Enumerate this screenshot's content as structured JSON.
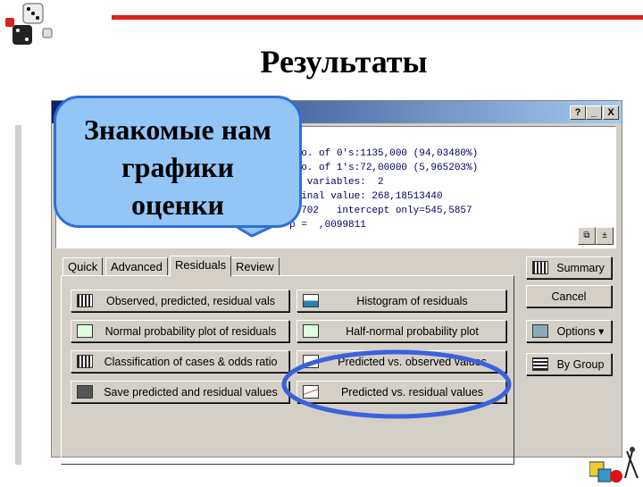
{
  "slide": {
    "title": "Результаты",
    "callout": [
      "Знакомые нам",
      "графики",
      "оценки"
    ]
  },
  "dialog": {
    "titlebar_buttons": {
      "help": "?",
      "minimize": "_",
      "close": "X"
    },
    "output_lines": [
      "git)  No. of 0's:1135,000 (94,03480%)",
      "      No. of 1's:72,00000 (5,965203%)",
      "pendent variables:  2",
      "hood  Final value: 268,18513440",
      "l=536,3702   intercept only=545,5857",
      "     p =  ,0099811"
    ],
    "tabs": [
      "Quick",
      "Advanced",
      "Residuals",
      "Review"
    ],
    "active_tab": "Residuals",
    "left_buttons": [
      "Observed, predicted, residual vals",
      "Normal probability plot of residuals",
      "Classification of cases & odds ratio",
      "Save predicted and residual values"
    ],
    "right_buttons": [
      "Histogram of residuals",
      "Half-normal probability plot",
      "Predicted vs. observed values",
      "Predicted vs. residual values"
    ],
    "side_buttons": {
      "summary": "Summary",
      "cancel": "Cancel",
      "options": "Options ▾",
      "by_group": "By Group"
    },
    "highlight_color": "#3a62dc"
  }
}
